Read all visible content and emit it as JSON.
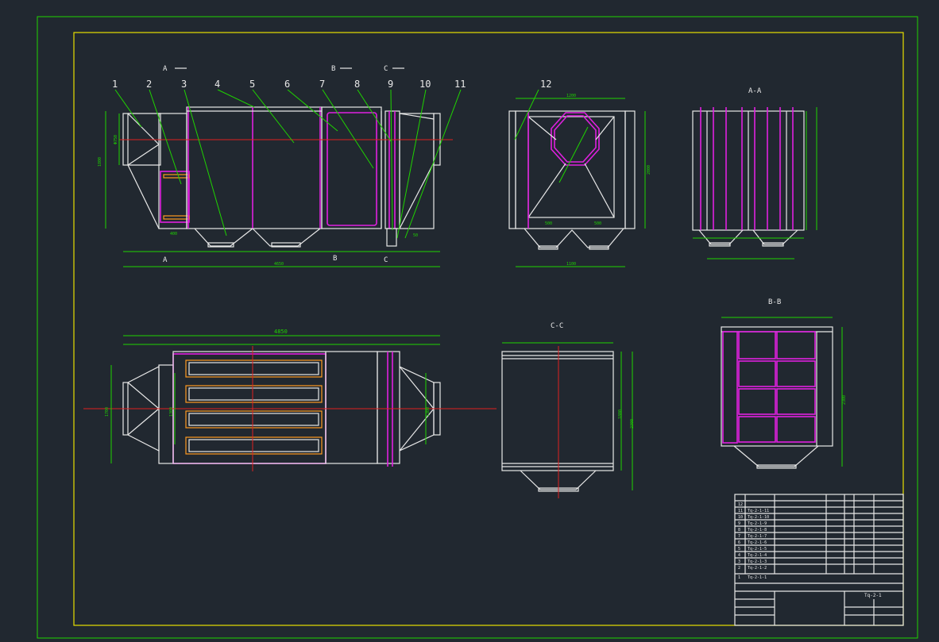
{
  "drawing": {
    "part_numbers": [
      "1",
      "2",
      "3",
      "4",
      "5",
      "6",
      "7",
      "8",
      "9",
      "10",
      "11",
      "12"
    ],
    "section_marks": {
      "a": "A",
      "b": "B",
      "c": "C"
    },
    "section_titles": {
      "aa": "A-A",
      "bb": "B-B",
      "cc": "C-C"
    },
    "dimensions": {
      "overall_length": "4650",
      "top_view_length": "4850",
      "height_1800": "1800",
      "dim_1700": "1700",
      "dim_1300": "1300",
      "dim_1200": "1200",
      "dim_1100": "1100",
      "dim_2000": "2000",
      "dim_2300": "2300",
      "dim_500": "500",
      "dim_400": "400",
      "dim_600": "600",
      "dim_150": "150",
      "dim_250": "250",
      "dim_50": "50",
      "dim_phi750": "Φ750"
    }
  },
  "title_block": {
    "drawing_no": "Tq-2-1",
    "rows": [
      {
        "no": "12",
        "code": "",
        "name": "",
        "qty": "1"
      },
      {
        "no": "11",
        "code": "Tq-2-1-11",
        "name": "",
        "qty": "1"
      },
      {
        "no": "10",
        "code": "Tq-2-1-10",
        "name": "",
        "qty": "1"
      },
      {
        "no": "9",
        "code": "Tq-2-1-9",
        "name": "",
        "qty": "1"
      },
      {
        "no": "8",
        "code": "Tq-2-1-8",
        "name": "",
        "qty": "1"
      },
      {
        "no": "7",
        "code": "Tq-2-1-7",
        "name": "",
        "qty": "1"
      },
      {
        "no": "6",
        "code": "Tq-2-1-6",
        "name": "",
        "qty": "1"
      },
      {
        "no": "5",
        "code": "Tq-2-1-5",
        "name": "",
        "qty": "1"
      },
      {
        "no": "4",
        "code": "Tq-2-1-4",
        "name": "",
        "qty": "1"
      },
      {
        "no": "3",
        "code": "Tq-2-1-3",
        "name": "",
        "qty": "1"
      },
      {
        "no": "2",
        "code": "Tq-2-1-2",
        "name": "",
        "qty": "1"
      },
      {
        "no": "1",
        "code": "Tq-2-1-1",
        "name": "",
        "qty": "1"
      }
    ]
  },
  "colors": {
    "background": "#212830",
    "frame": "#1fd400",
    "border": "#e8e000",
    "outline": "#e8e8e8",
    "highlight": "#e020e0",
    "centerline": "#e02020"
  }
}
